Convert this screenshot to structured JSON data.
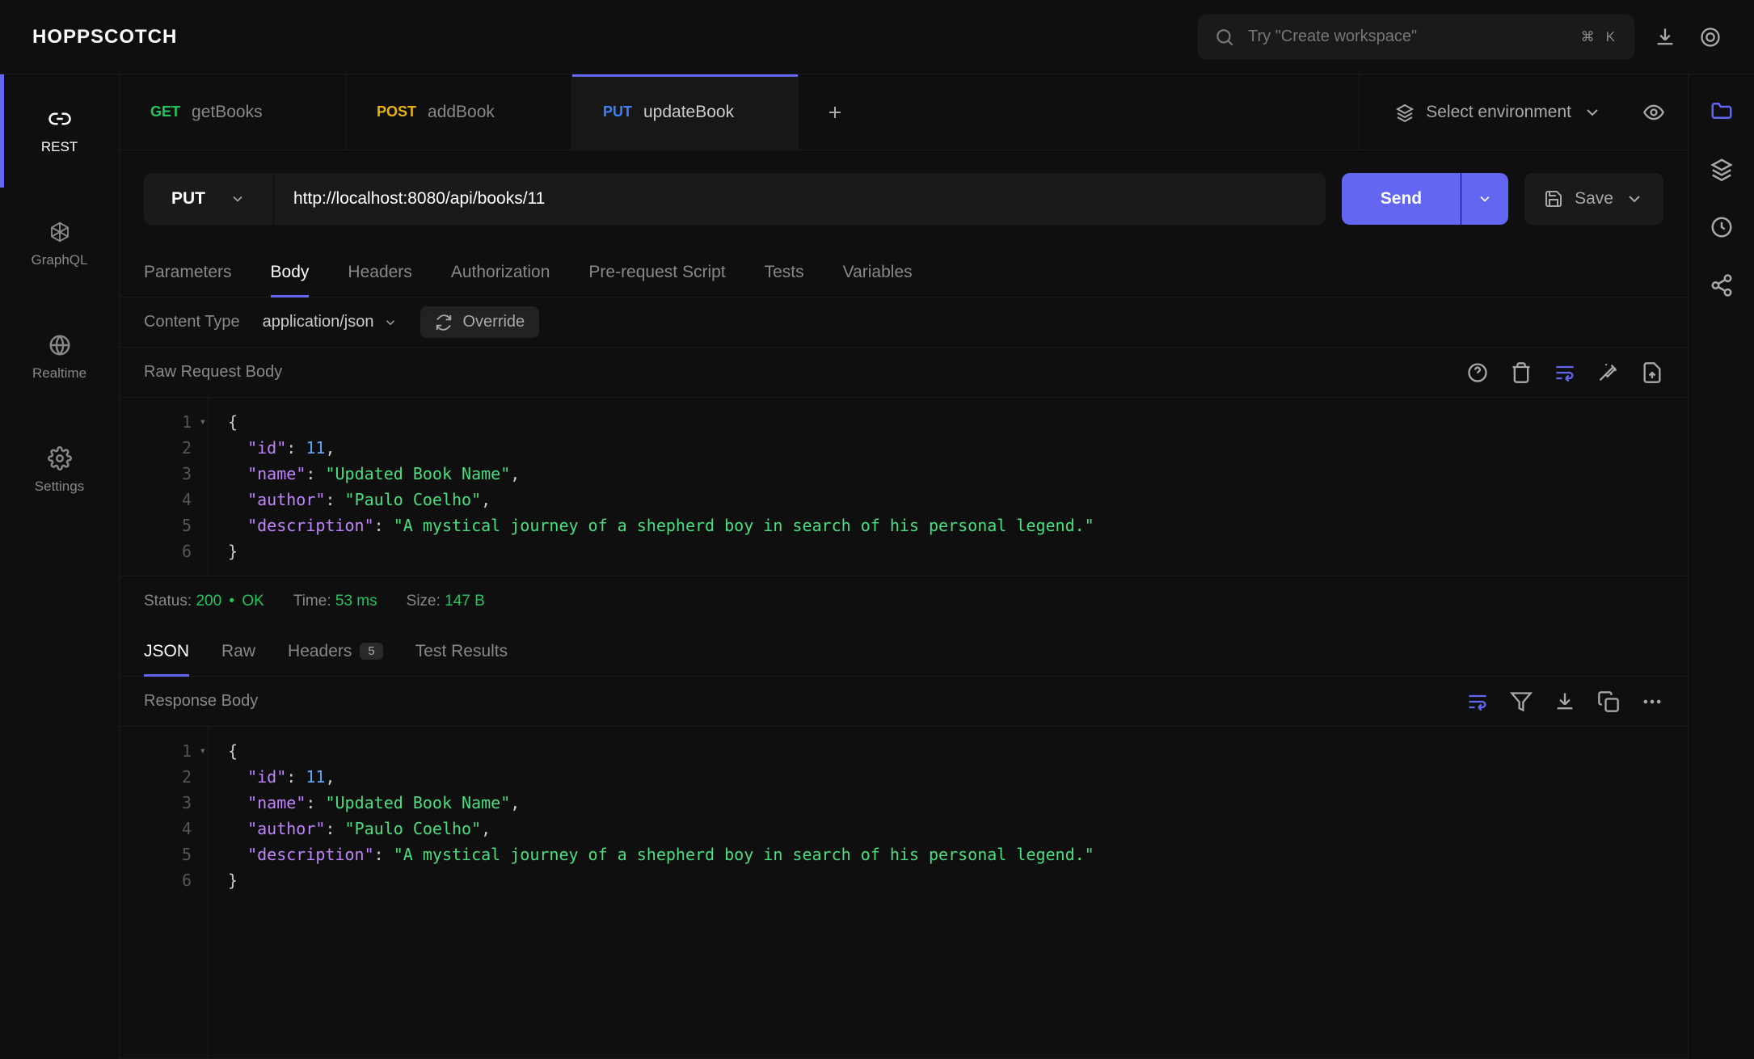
{
  "app": {
    "title": "HOPPSCOTCH"
  },
  "topbar": {
    "search_placeholder": "Try \"Create workspace\"",
    "shortcut_mod": "⌘",
    "shortcut_key": "K"
  },
  "sidebar": {
    "items": [
      {
        "label": "REST",
        "active": true
      },
      {
        "label": "GraphQL",
        "active": false
      },
      {
        "label": "Realtime",
        "active": false
      },
      {
        "label": "Settings",
        "active": false
      }
    ]
  },
  "tabs": {
    "items": [
      {
        "method": "GET",
        "name": "getBooks",
        "active": false
      },
      {
        "method": "POST",
        "name": "addBook",
        "active": false
      },
      {
        "method": "PUT",
        "name": "updateBook",
        "active": true
      }
    ],
    "env_label": "Select environment"
  },
  "request": {
    "method": "PUT",
    "url": "http://localhost:8080/api/books/11",
    "send_label": "Send",
    "save_label": "Save"
  },
  "section_tabs": [
    "Parameters",
    "Body",
    "Headers",
    "Authorization",
    "Pre-request Script",
    "Tests",
    "Variables"
  ],
  "section_active": "Body",
  "content_type": {
    "label": "Content Type",
    "value": "application/json",
    "override_label": "Override"
  },
  "raw_header": {
    "title": "Raw Request Body"
  },
  "request_body": {
    "id_key": "id",
    "id_val": "11",
    "name_key": "name",
    "name_val": "Updated Book Name",
    "author_key": "author",
    "author_val": "Paulo Coelho",
    "description_key": "description",
    "description_val": "A mystical journey of a shepherd boy in search of his personal legend."
  },
  "status": {
    "status_label": "Status:",
    "code": "200",
    "text": "OK",
    "time_label": "Time:",
    "time_val": "53 ms",
    "size_label": "Size:",
    "size_val": "147 B"
  },
  "response_tabs": {
    "items": [
      "JSON",
      "Raw",
      "Headers",
      "Test Results"
    ],
    "headers_count": "5",
    "active": "JSON"
  },
  "response_header": {
    "title": "Response Body"
  },
  "response_body": {
    "id_key": "id",
    "id_val": "11",
    "name_key": "name",
    "name_val": "Updated Book Name",
    "author_key": "author",
    "author_val": "Paulo Coelho",
    "description_key": "description",
    "description_val": "A mystical journey of a shepherd boy in search of his personal legend."
  }
}
